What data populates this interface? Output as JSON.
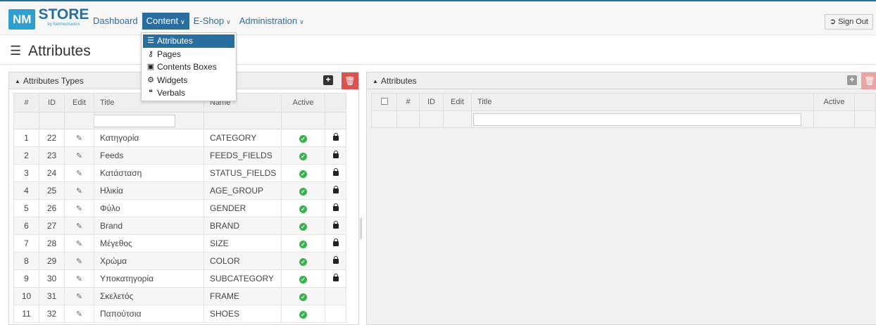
{
  "app": {
    "logo_nm": "NM",
    "logo_store": "STORE",
    "logo_sub": "by Netmechanics"
  },
  "nav": {
    "items": [
      {
        "label": "Dashboard"
      },
      {
        "label": "Content"
      },
      {
        "label": "E-Shop"
      },
      {
        "label": "Administration"
      }
    ],
    "signout_label": "Sign Out"
  },
  "content_menu": {
    "items": [
      {
        "label": "Attributes",
        "icon": "list-icon"
      },
      {
        "label": "Pages",
        "icon": "sitemap-icon"
      },
      {
        "label": "Contents Boxes",
        "icon": "archive-icon"
      },
      {
        "label": "Widgets",
        "icon": "cogs-icon"
      },
      {
        "label": "Verbals",
        "icon": "quote-icon"
      }
    ]
  },
  "page": {
    "title": "Attributes"
  },
  "types_panel": {
    "title": "Attributes Types",
    "columns": [
      "#",
      "ID",
      "Edit",
      "Title",
      "Name",
      "Active",
      ""
    ],
    "rows": [
      {
        "n": "1",
        "id": "22",
        "title": "Κατηγορία",
        "name": "CATEGORY",
        "locked": true
      },
      {
        "n": "2",
        "id": "23",
        "title": "Feeds",
        "name": "FEEDS_FIELDS",
        "locked": true
      },
      {
        "n": "3",
        "id": "24",
        "title": "Κατάσταση",
        "name": "STATUS_FIELDS",
        "locked": true
      },
      {
        "n": "4",
        "id": "25",
        "title": "Ηλικία",
        "name": "AGE_GROUP",
        "locked": true
      },
      {
        "n": "5",
        "id": "26",
        "title": "Φύλο",
        "name": "GENDER",
        "locked": true
      },
      {
        "n": "6",
        "id": "27",
        "title": "Brand",
        "name": "BRAND",
        "locked": true
      },
      {
        "n": "7",
        "id": "28",
        "title": "Μέγεθος",
        "name": "SIZE",
        "locked": true
      },
      {
        "n": "8",
        "id": "29",
        "title": "Χρώμα",
        "name": "COLOR",
        "locked": true
      },
      {
        "n": "9",
        "id": "30",
        "title": "Υποκατηγορία",
        "name": "SUBCATEGORY",
        "locked": true
      },
      {
        "n": "10",
        "id": "31",
        "title": "Σκελετός",
        "name": "FRAME",
        "locked": false
      },
      {
        "n": "11",
        "id": "32",
        "title": "Παπούτσια",
        "name": "SHOES",
        "locked": false
      }
    ]
  },
  "attributes_panel": {
    "title": "Attributes",
    "columns": [
      "",
      "#",
      "ID",
      "Edit",
      "Title",
      "Active"
    ]
  },
  "colors": {
    "brand_blue": "#2a6ea0",
    "active_green": "#37b24d",
    "delete_red": "#d9534f"
  }
}
